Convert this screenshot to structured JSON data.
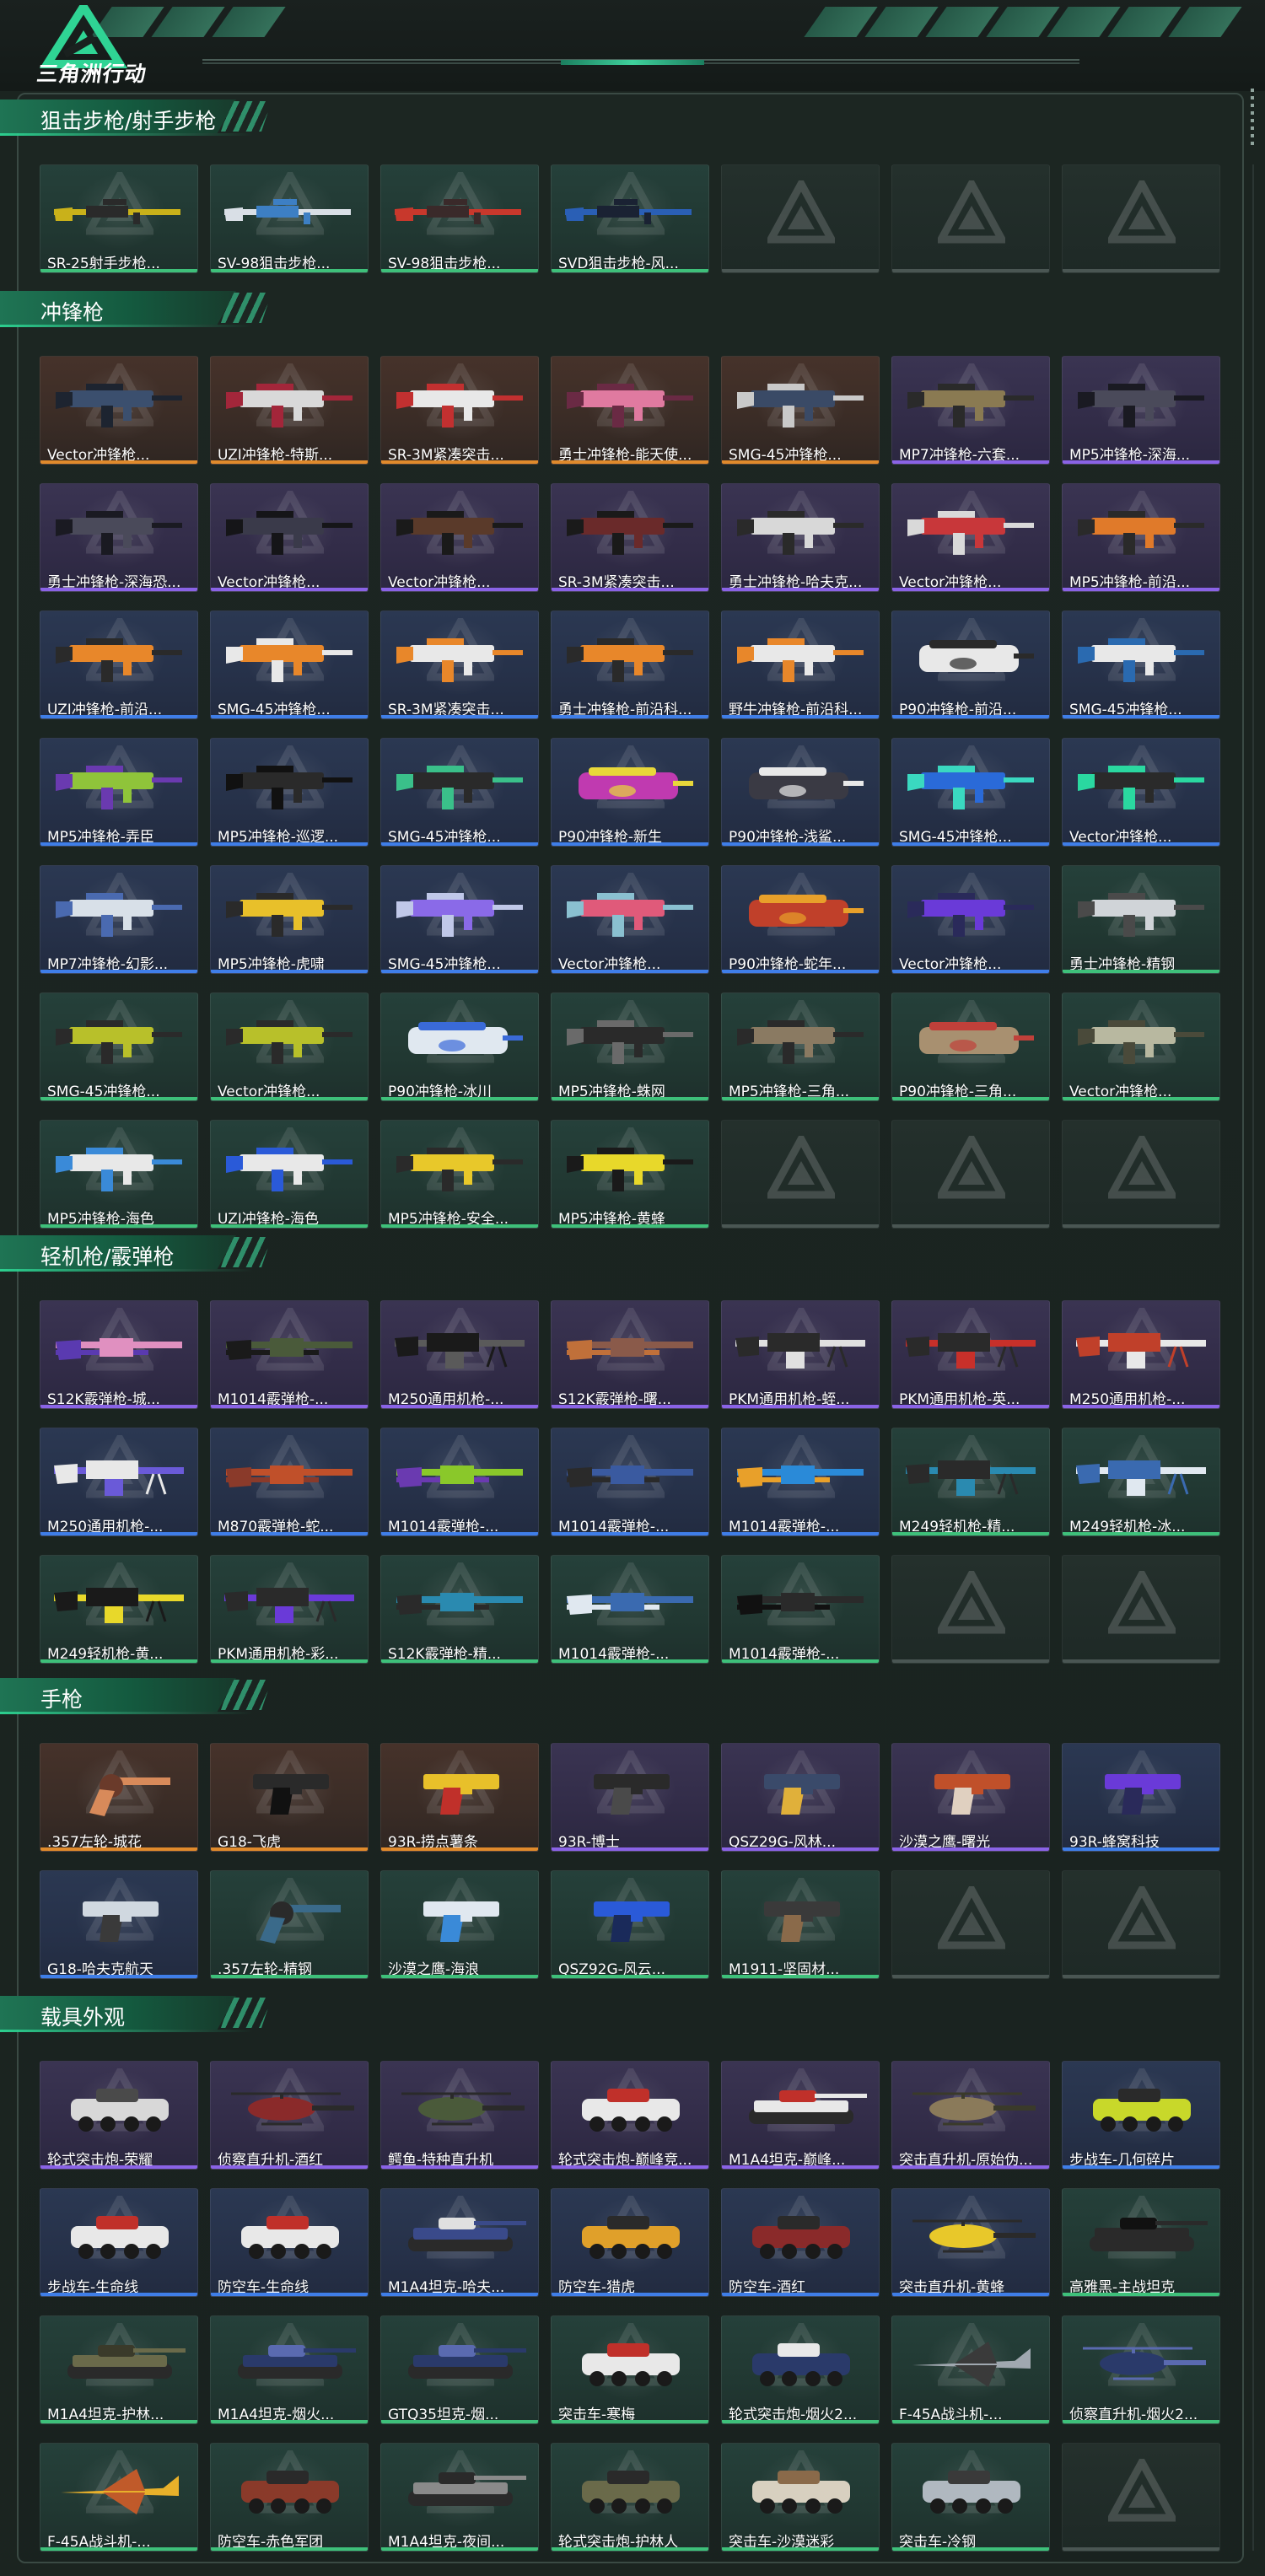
{
  "app": {
    "logo_text": "三角洲行动",
    "colors": {
      "accent": "#2ccf8f",
      "orange": "#e08a2c",
      "purple": "#8a63e6",
      "blue": "#3f7ee8",
      "green": "#3ec07a"
    }
  },
  "sections": [
    {
      "title": "狙击步枪/射手步枪",
      "items": [
        {
          "name": "SR-25射手步枪...",
          "rarity": "green",
          "shape": "rifle",
          "c1": "#c9b11a",
          "c2": "#2a2a2a"
        },
        {
          "name": "SV-98狙击步枪...",
          "rarity": "green",
          "shape": "rifle",
          "c1": "#d9dfe6",
          "c2": "#3d7fc4"
        },
        {
          "name": "SV-98狙击步枪...",
          "rarity": "green",
          "shape": "rifle",
          "c1": "#c8382c",
          "c2": "#3a2a2a"
        },
        {
          "name": "SVD狙击步枪-风...",
          "rarity": "green",
          "shape": "rifle",
          "c1": "#2a5fb5",
          "c2": "#1a2233"
        }
      ],
      "empty_slots": 3
    },
    {
      "title": "冲锋枪",
      "items": [
        {
          "name": "Vector冲锋枪...",
          "rarity": "orange",
          "shape": "smg",
          "c1": "#3b4f6e",
          "c2": "#1d2430"
        },
        {
          "name": "UZI冲锋枪-特斯...",
          "rarity": "orange",
          "shape": "smg",
          "c1": "#d9d9d9",
          "c2": "#a3263a"
        },
        {
          "name": "SR-3M紧凑突击...",
          "rarity": "orange",
          "shape": "smg",
          "c1": "#e8e8e8",
          "c2": "#c23030"
        },
        {
          "name": "勇士冲锋枪-能天使...",
          "rarity": "orange",
          "shape": "smg",
          "c1": "#e07aa0",
          "c2": "#6a2a44"
        },
        {
          "name": "SMG-45冲锋枪...",
          "rarity": "orange",
          "shape": "smg",
          "c1": "#3a4a66",
          "c2": "#c9c9c9"
        },
        {
          "name": "MP7冲锋枪-六套...",
          "rarity": "purple",
          "shape": "smg",
          "c1": "#8a7a52",
          "c2": "#2a2a2a"
        },
        {
          "name": "MP5冲锋枪-深海...",
          "rarity": "purple",
          "shape": "smg",
          "c1": "#4a4a5a",
          "c2": "#1a1a22"
        },
        {
          "name": "勇士冲锋枪-深海恐...",
          "rarity": "purple",
          "shape": "smg",
          "c1": "#4a4a5a",
          "c2": "#1a1a22"
        },
        {
          "name": "Vector冲锋枪...",
          "rarity": "purple",
          "shape": "smg",
          "c1": "#3a3a4a",
          "c2": "#151518"
        },
        {
          "name": "Vector冲锋枪...",
          "rarity": "purple",
          "shape": "smg",
          "c1": "#5a3a2a",
          "c2": "#1a1a1a"
        },
        {
          "name": "SR-3M紧凑突击...",
          "rarity": "purple",
          "shape": "smg",
          "c1": "#6a2a2a",
          "c2": "#1a1a1a"
        },
        {
          "name": "勇士冲锋枪-哈夫克...",
          "rarity": "purple",
          "shape": "smg",
          "c1": "#d8d8d8",
          "c2": "#2a2a2a"
        },
        {
          "name": "Vector冲锋枪...",
          "rarity": "purple",
          "shape": "smg",
          "c1": "#c8373a",
          "c2": "#d9d9d9"
        },
        {
          "name": "MP5冲锋枪-前沿...",
          "rarity": "purple",
          "shape": "smg",
          "c1": "#e07a2a",
          "c2": "#2a2a2a"
        },
        {
          "name": "UZI冲锋枪-前沿...",
          "rarity": "blue",
          "shape": "smg",
          "c1": "#e8872a",
          "c2": "#2a2a2a"
        },
        {
          "name": "SMG-45冲锋枪...",
          "rarity": "blue",
          "shape": "smg",
          "c1": "#e8872a",
          "c2": "#e8e8e8"
        },
        {
          "name": "SR-3M紧凑突击...",
          "rarity": "blue",
          "shape": "smg",
          "c1": "#e8e8e8",
          "c2": "#e8872a"
        },
        {
          "name": "勇士冲锋枪-前沿科...",
          "rarity": "blue",
          "shape": "smg",
          "c1": "#e8872a",
          "c2": "#2a2a2a"
        },
        {
          "name": "野牛冲锋枪-前沿科...",
          "rarity": "blue",
          "shape": "smg",
          "c1": "#e8e8e8",
          "c2": "#e8872a"
        },
        {
          "name": "P90冲锋枪-前沿...",
          "rarity": "blue",
          "shape": "p90",
          "c1": "#e8e8e8",
          "c2": "#2a2a2a"
        },
        {
          "name": "SMG-45冲锋枪...",
          "rarity": "blue",
          "shape": "smg",
          "c1": "#e8e8e8",
          "c2": "#2a6ab0"
        },
        {
          "name": "MP5冲锋枪-弄臣",
          "rarity": "blue",
          "shape": "smg",
          "c1": "#8fc43a",
          "c2": "#6a3ab0"
        },
        {
          "name": "MP5冲锋枪-巡逻...",
          "rarity": "blue",
          "shape": "smg",
          "c1": "#2a2a2a",
          "c2": "#111111"
        },
        {
          "name": "SMG-45冲锋枪...",
          "rarity": "blue",
          "shape": "smg",
          "c1": "#2a2a2a",
          "c2": "#3ac08a"
        },
        {
          "name": "P90冲锋枪-新生",
          "rarity": "blue",
          "shape": "p90",
          "c1": "#c03ab0",
          "c2": "#e8d83a"
        },
        {
          "name": "P90冲锋枪-浅鲨...",
          "rarity": "blue",
          "shape": "p90",
          "c1": "#3a3a44",
          "c2": "#e8e8e8"
        },
        {
          "name": "SMG-45冲锋枪...",
          "rarity": "blue",
          "shape": "smg",
          "c1": "#2a6ad8",
          "c2": "#3ad8c0"
        },
        {
          "name": "Vector冲锋枪...",
          "rarity": "blue",
          "shape": "smg",
          "c1": "#2a2a2a",
          "c2": "#2ad8a0"
        },
        {
          "name": "MP7冲锋枪-幻影...",
          "rarity": "blue",
          "shape": "smg",
          "c1": "#d8e0e8",
          "c2": "#4a6ab0"
        },
        {
          "name": "MP5冲锋枪-虎啸",
          "rarity": "blue",
          "shape": "smg",
          "c1": "#e8c02a",
          "c2": "#2a2a2a"
        },
        {
          "name": "SMG-45冲锋枪...",
          "rarity": "blue",
          "shape": "smg",
          "c1": "#8a6ae8",
          "c2": "#c0c8e8"
        },
        {
          "name": "Vector冲锋枪...",
          "rarity": "blue",
          "shape": "smg",
          "c1": "#e05a7a",
          "c2": "#8ac0d0"
        },
        {
          "name": "P90冲锋枪-蛇年...",
          "rarity": "blue",
          "shape": "p90",
          "c1": "#c0402a",
          "c2": "#e8a02a"
        },
        {
          "name": "Vector冲锋枪...",
          "rarity": "blue",
          "shape": "smg",
          "c1": "#6a3ad8",
          "c2": "#2a2a5a"
        },
        {
          "name": "勇士冲锋枪-精钢",
          "rarity": "green",
          "shape": "smg",
          "c1": "#d0d4d8",
          "c2": "#4a4a4a"
        },
        {
          "name": "SMG-45冲锋枪...",
          "rarity": "green",
          "shape": "smg",
          "c1": "#b8c02a",
          "c2": "#2a2a2a"
        },
        {
          "name": "Vector冲锋枪...",
          "rarity": "green",
          "shape": "smg",
          "c1": "#b8c02a",
          "c2": "#2a2a2a"
        },
        {
          "name": "P90冲锋枪-冰川",
          "rarity": "green",
          "shape": "p90",
          "c1": "#e0e8f0",
          "c2": "#3a6ad8"
        },
        {
          "name": "MP5冲锋枪-蛛网",
          "rarity": "green",
          "shape": "smg",
          "c1": "#2a2a2a",
          "c2": "#6a6a6a"
        },
        {
          "name": "MP5冲锋枪-三角...",
          "rarity": "green",
          "shape": "smg",
          "c1": "#8a7a62",
          "c2": "#2a2a2a"
        },
        {
          "name": "P90冲锋枪-三角...",
          "rarity": "green",
          "shape": "p90",
          "c1": "#a89070",
          "c2": "#c0403a"
        },
        {
          "name": "Vector冲锋枪...",
          "rarity": "green",
          "shape": "smg",
          "c1": "#b8b8a0",
          "c2": "#4a4a3a"
        },
        {
          "name": "MP5冲锋枪-海色",
          "rarity": "green",
          "shape": "smg",
          "c1": "#e8e8e8",
          "c2": "#3a8ad8"
        },
        {
          "name": "UZI冲锋枪-海色",
          "rarity": "green",
          "shape": "smg",
          "c1": "#e8e8e8",
          "c2": "#2a5ad8"
        },
        {
          "name": "MP5冲锋枪-安全...",
          "rarity": "green",
          "shape": "smg",
          "c1": "#e8c82a",
          "c2": "#2a2a2a"
        },
        {
          "name": "MP5冲锋枪-黄蜂",
          "rarity": "green",
          "shape": "smg",
          "c1": "#e8d82a",
          "c2": "#1a1a1a"
        }
      ],
      "empty_slots": 3
    },
    {
      "title": "轻机枪/霰弹枪",
      "items": [
        {
          "name": "S12K霰弹枪-城...",
          "rarity": "purple",
          "shape": "shotgun",
          "c1": "#e090c0",
          "c2": "#5a3ab0"
        },
        {
          "name": "M1014霰弹枪-...",
          "rarity": "purple",
          "shape": "shotgun",
          "c1": "#4a5a3a",
          "c2": "#1a1a1a"
        },
        {
          "name": "M250通用机枪-...",
          "rarity": "purple",
          "shape": "lmg",
          "c1": "#5a5a5a",
          "c2": "#1a1a1a"
        },
        {
          "name": "S12K霰弹枪-曙...",
          "rarity": "purple",
          "shape": "shotgun",
          "c1": "#8a5a4a",
          "c2": "#c0703a"
        },
        {
          "name": "PKM通用机枪-蛭...",
          "rarity": "purple",
          "shape": "lmg",
          "c1": "#e0e0e0",
          "c2": "#2a2a2a"
        },
        {
          "name": "PKM通用机枪-英...",
          "rarity": "purple",
          "shape": "lmg",
          "c1": "#c8302a",
          "c2": "#2a2a2a"
        },
        {
          "name": "M250通用机枪-...",
          "rarity": "purple",
          "shape": "lmg",
          "c1": "#e8e8e8",
          "c2": "#c0402a"
        },
        {
          "name": "M250通用机枪-...",
          "rarity": "blue",
          "shape": "lmg",
          "c1": "#6a5ad8",
          "c2": "#e8e8e8"
        },
        {
          "name": "M870霰弹枪-蛇...",
          "rarity": "blue",
          "shape": "shotgun",
          "c1": "#c0502a",
          "c2": "#8a3a2a"
        },
        {
          "name": "M1014霰弹枪-...",
          "rarity": "blue",
          "shape": "shotgun",
          "c1": "#8ac82a",
          "c2": "#6a3ab0"
        },
        {
          "name": "M1014霰弹枪-...",
          "rarity": "blue",
          "shape": "shotgun",
          "c1": "#3a5aa0",
          "c2": "#2a2a2a"
        },
        {
          "name": "M1014霰弹枪-...",
          "rarity": "blue",
          "shape": "shotgun",
          "c1": "#2a8ad8",
          "c2": "#e8a02a"
        },
        {
          "name": "M249轻机枪-精...",
          "rarity": "green",
          "shape": "lmg",
          "c1": "#2a8ab0",
          "c2": "#2a2a2a"
        },
        {
          "name": "M249轻机枪-冰...",
          "rarity": "green",
          "shape": "lmg",
          "c1": "#e0e8f0",
          "c2": "#3a6ab0"
        },
        {
          "name": "M249轻机枪-黄...",
          "rarity": "green",
          "shape": "lmg",
          "c1": "#e8d82a",
          "c2": "#1a1a1a"
        },
        {
          "name": "PKM通用机枪-彩...",
          "rarity": "green",
          "shape": "lmg",
          "c1": "#6a3ad8",
          "c2": "#2a2a2a"
        },
        {
          "name": "S12K霰弹枪-精...",
          "rarity": "green",
          "shape": "shotgun",
          "c1": "#2a8ab0",
          "c2": "#2a2a2a"
        },
        {
          "name": "M1014霰弹枪-...",
          "rarity": "green",
          "shape": "shotgun",
          "c1": "#3a6ab0",
          "c2": "#e0e8f0"
        },
        {
          "name": "M1014霰弹枪-...",
          "rarity": "green",
          "shape": "shotgun",
          "c1": "#2a2a2a",
          "c2": "#111111"
        }
      ],
      "empty_slots": 2
    },
    {
      "title": "手枪",
      "items": [
        {
          "name": ".357左轮-城花",
          "rarity": "orange",
          "shape": "revolver",
          "c1": "#d88a5a",
          "c2": "#6a3a2a"
        },
        {
          "name": "G18-飞虎",
          "rarity": "orange",
          "shape": "pistol",
          "c1": "#2a2a2a",
          "c2": "#111111"
        },
        {
          "name": "93R-捞点薯条",
          "rarity": "orange",
          "shape": "pistol",
          "c1": "#e8c02a",
          "c2": "#c0302a"
        },
        {
          "name": "93R-博士",
          "rarity": "purple",
          "shape": "pistol",
          "c1": "#2a2a2a",
          "c2": "#4a4a4a"
        },
        {
          "name": "QSZ29G-风林...",
          "rarity": "purple",
          "shape": "pistol",
          "c1": "#3a4a6a",
          "c2": "#e0b03a"
        },
        {
          "name": "沙漠之鹰-曙光",
          "rarity": "purple",
          "shape": "pistol",
          "c1": "#c0502a",
          "c2": "#e0d0c0"
        },
        {
          "name": "93R-蜂窝科技",
          "rarity": "blue",
          "shape": "pistol",
          "c1": "#6a3ad8",
          "c2": "#2a2a5a"
        },
        {
          "name": "G18-哈夫克航天",
          "rarity": "blue",
          "shape": "pistol",
          "c1": "#d0d8e0",
          "c2": "#3a3a3a"
        },
        {
          "name": ".357左轮-精钢",
          "rarity": "green",
          "shape": "revolver",
          "c1": "#3a6a8a",
          "c2": "#2a2a2a"
        },
        {
          "name": "沙漠之鹰-海浪",
          "rarity": "green",
          "shape": "pistol",
          "c1": "#e0e8f0",
          "c2": "#3a8ad8"
        },
        {
          "name": "QSZ92G-风云...",
          "rarity": "green",
          "shape": "pistol",
          "c1": "#2a5ad8",
          "c2": "#1a2a5a"
        },
        {
          "name": "M1911-坚固材...",
          "rarity": "green",
          "shape": "pistol",
          "c1": "#3a3a3a",
          "c2": "#8a6a4a"
        }
      ],
      "empty_slots": 2
    },
    {
      "title": "载具外观",
      "items": [
        {
          "name": "轮式突击炮-荣耀",
          "rarity": "purple",
          "shape": "vehicle",
          "c1": "#d8d8d8",
          "c2": "#4a4a4a"
        },
        {
          "name": "侦察直升机-酒红",
          "rarity": "purple",
          "shape": "heli",
          "c1": "#8a2a2a",
          "c2": "#2a2a2a"
        },
        {
          "name": "鳄鱼-特种直升机",
          "rarity": "purple",
          "shape": "heli",
          "c1": "#4a5a3a",
          "c2": "#2a2a2a"
        },
        {
          "name": "轮式突击炮-巅峰竞...",
          "rarity": "purple",
          "shape": "vehicle",
          "c1": "#e8e8e8",
          "c2": "#c0302a"
        },
        {
          "name": "M1A4坦克-巅峰...",
          "rarity": "purple",
          "shape": "tank",
          "c1": "#e8e8e8",
          "c2": "#c0302a"
        },
        {
          "name": "突击直升机-原始伪...",
          "rarity": "purple",
          "shape": "heli",
          "c1": "#8a7a5a",
          "c2": "#3a3a2a"
        },
        {
          "name": "步战车-几何碎片",
          "rarity": "blue",
          "shape": "vehicle",
          "c1": "#c8d82a",
          "c2": "#2a2a2a"
        },
        {
          "name": "步战车-生命线",
          "rarity": "blue",
          "shape": "vehicle",
          "c1": "#e8e8e8",
          "c2": "#c0302a"
        },
        {
          "name": "防空车-生命线",
          "rarity": "blue",
          "shape": "vehicle",
          "c1": "#e8e8e8",
          "c2": "#c0302a"
        },
        {
          "name": "M1A4坦克-哈夫...",
          "rarity": "blue",
          "shape": "tank",
          "c1": "#3a4a8a",
          "c2": "#e0e0e0"
        },
        {
          "name": "防空车-猎虎",
          "rarity": "blue",
          "shape": "vehicle",
          "c1": "#e0a02a",
          "c2": "#2a2a2a"
        },
        {
          "name": "防空车-酒红",
          "rarity": "blue",
          "shape": "vehicle",
          "c1": "#8a2a2a",
          "c2": "#2a2a2a"
        },
        {
          "name": "突击直升机-黄蜂",
          "rarity": "blue",
          "shape": "heli",
          "c1": "#e8c82a",
          "c2": "#2a2a2a"
        },
        {
          "name": "高雅黑-主战坦克",
          "rarity": "green",
          "shape": "tank",
          "c1": "#2a2a2a",
          "c2": "#111111"
        },
        {
          "name": "M1A4坦克-护林...",
          "rarity": "green",
          "shape": "tank",
          "c1": "#6a6a4a",
          "c2": "#3a3a2a"
        },
        {
          "name": "M1A4坦克-烟火...",
          "rarity": "green",
          "shape": "tank",
          "c1": "#2a3a6a",
          "c2": "#5a6ab0"
        },
        {
          "name": "GTQ35坦克-烟...",
          "rarity": "green",
          "shape": "tank",
          "c1": "#2a3a6a",
          "c2": "#5a6ab0"
        },
        {
          "name": "突击车-寒梅",
          "rarity": "green",
          "shape": "vehicle",
          "c1": "#e8e8e8",
          "c2": "#c0302a"
        },
        {
          "name": "轮式突击炮-烟火2...",
          "rarity": "green",
          "shape": "vehicle",
          "c1": "#2a3a6a",
          "c2": "#e8e8e8"
        },
        {
          "name": "F-45A战斗机-...",
          "rarity": "green",
          "shape": "jet",
          "c1": "#a0a8b0",
          "c2": "#3a3a3a"
        },
        {
          "name": "侦察直升机-烟火2...",
          "rarity": "green",
          "shape": "heli",
          "c1": "#2a3a6a",
          "c2": "#5a6ab0"
        },
        {
          "name": "F-45A战斗机-...",
          "rarity": "green",
          "shape": "jet",
          "c1": "#e8b02a",
          "c2": "#c05a2a"
        },
        {
          "name": "防空车-赤色军团",
          "rarity": "green",
          "shape": "vehicle",
          "c1": "#8a3a2a",
          "c2": "#2a2a2a"
        },
        {
          "name": "M1A4坦克-夜间...",
          "rarity": "green",
          "shape": "tank",
          "c1": "#8a8a8a",
          "c2": "#2a2a2a"
        },
        {
          "name": "轮式突击炮-护林人",
          "rarity": "green",
          "shape": "vehicle",
          "c1": "#6a6a4a",
          "c2": "#2a2a2a"
        },
        {
          "name": "突击车-沙漠迷彩",
          "rarity": "green",
          "shape": "vehicle",
          "c1": "#d8d0c0",
          "c2": "#8a6a4a"
        },
        {
          "name": "突击车-冷钢",
          "rarity": "green",
          "shape": "vehicle",
          "c1": "#b0b8c0",
          "c2": "#3a3a3a"
        }
      ],
      "empty_slots": 1
    }
  ]
}
